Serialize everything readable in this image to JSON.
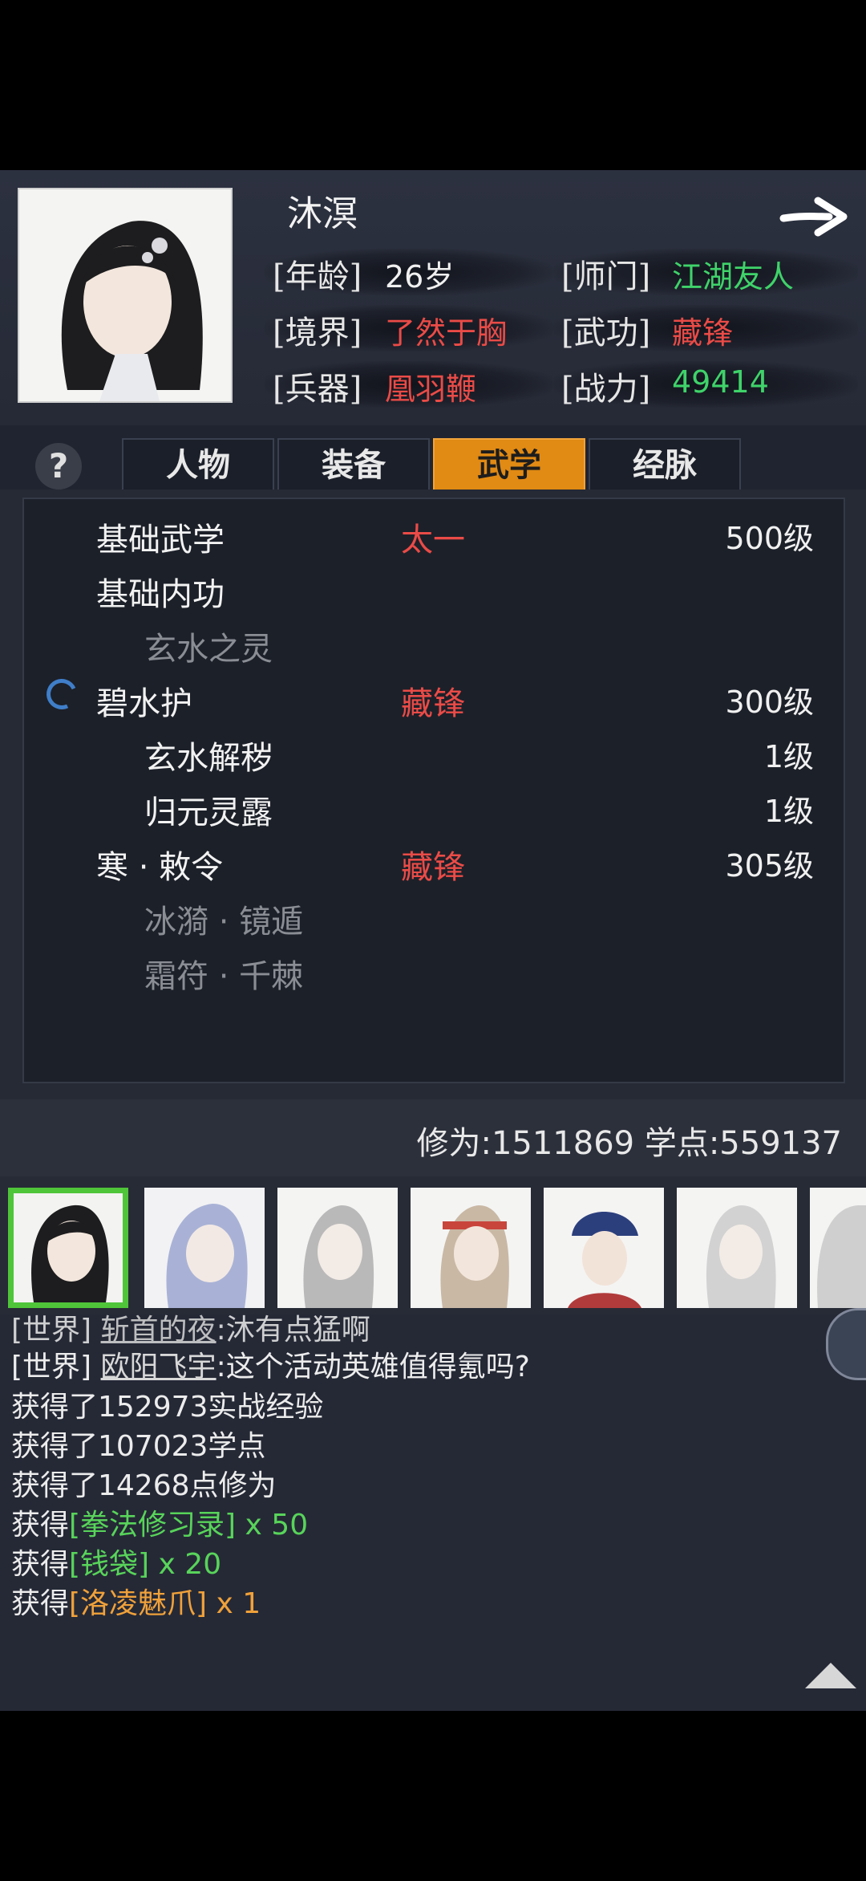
{
  "character": {
    "name": "沐溟",
    "fields": [
      {
        "label": "[年龄]",
        "value": "26岁"
      },
      {
        "label": "[师门]",
        "value": "江湖友人"
      },
      {
        "label": "[境界]",
        "value": "了然于胸"
      },
      {
        "label": "[武功]",
        "value": "藏锋"
      },
      {
        "label": "[兵器]",
        "value": "凰羽鞭"
      },
      {
        "label": "[战力]",
        "value": "49414"
      }
    ]
  },
  "help": "?",
  "tabs": [
    {
      "label": "人物",
      "active": false
    },
    {
      "label": "装备",
      "active": false
    },
    {
      "label": "武学",
      "active": true
    },
    {
      "label": "经脉",
      "active": false
    }
  ],
  "skills": [
    {
      "name": "基础武学",
      "school": "太一",
      "level": "500级"
    },
    {
      "name": "基础内功",
      "school": "",
      "level": ""
    },
    {
      "name": "玄水之灵",
      "school": "",
      "level": ""
    },
    {
      "name": "碧水护",
      "school": "藏锋",
      "level": "300级"
    },
    {
      "name": "玄水解秽",
      "school": "",
      "level": "1级"
    },
    {
      "name": "归元灵露",
      "school": "",
      "level": "1级"
    },
    {
      "name": "寒 · 敕令",
      "school": "藏锋",
      "level": "305级"
    },
    {
      "name": "冰漪 · 镜遁",
      "school": "",
      "level": ""
    },
    {
      "name": "霜符 · 千棘",
      "school": "",
      "level": ""
    }
  ],
  "stats": {
    "text": "修为:1511869  学点:559137"
  },
  "chat": {
    "partial": {
      "tag": "[世界]",
      "user": "斩首的夜",
      "msg": ":沐有点猛啊"
    },
    "world": {
      "tag": "[世界]",
      "user": "欧阳飞宇",
      "msg": ":这个活动英雄值得氪吗?"
    },
    "gains": [
      "获得了152973实战经验",
      "获得了107023学点",
      "获得了14268点修为"
    ],
    "items": [
      {
        "prefix": "获得",
        "item": "[拳法修习录]",
        "qty": " x 50"
      },
      {
        "prefix": "获得",
        "item": "[钱袋]",
        "qty": " x 20"
      },
      {
        "prefix": "获得",
        "item": "[洛凌魅爪]",
        "qty": " x 1"
      }
    ]
  },
  "colors": {
    "accent_tab": "#e18a14",
    "red": "#ea4b47",
    "green": "#3fd36a",
    "selected_border": "#4fc53a"
  }
}
